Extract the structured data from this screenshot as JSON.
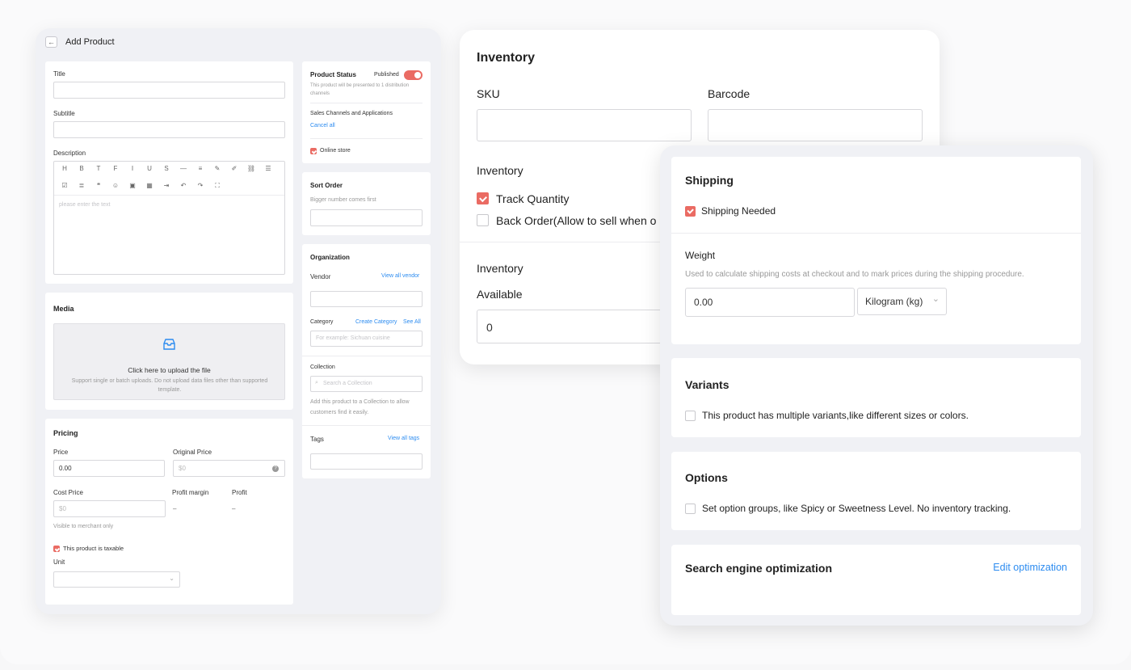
{
  "colors": {
    "accent": "#ea6b63",
    "link": "#2d8cf0"
  },
  "add_product": {
    "title": "Add Product",
    "title_label": "Title",
    "subtitle_label": "Subtitle",
    "description_label": "Description",
    "description_placeholder": "please enter the text",
    "toolbar_row1": [
      "H",
      "B",
      "T",
      "F",
      "I",
      "U",
      "S",
      "—",
      "≡",
      "✎",
      "✐",
      "⛓",
      "☰"
    ],
    "toolbar_row2": [
      "☑",
      "≣",
      "❝",
      "☺",
      "▣",
      "▦",
      "⇥",
      "↶",
      "↷",
      "⛶"
    ],
    "media": {
      "title": "Media",
      "upload_title": "Click here to upload the file",
      "upload_hint": "Support single or batch uploads. Do not upload data files other than supported template."
    },
    "pricing": {
      "title": "Pricing",
      "price_label": "Price",
      "price_value": "0.00",
      "original_price_label": "Original Price",
      "original_price_placeholder": "$0",
      "cost_price_label": "Cost Price",
      "cost_price_placeholder": "$0",
      "profit_margin_label": "Profit margin",
      "profit_margin_value": "–",
      "profit_label": "Profit",
      "profit_value": "–",
      "visible_note": "Visible to merchant only",
      "taxable_label": "This product is taxable",
      "unit_label": "Unit"
    },
    "status": {
      "title": "Product Status",
      "toggle_label": "Published",
      "note": "This product will be presented to 1 distribution channels",
      "channels_label": "Sales Channels and Applications",
      "cancel_all": "Cancel all",
      "online_store": "Online store"
    },
    "sort": {
      "title": "Sort Order",
      "hint": "Bigger number comes first"
    },
    "organization": {
      "title": "Organization",
      "vendor_label": "Vendor",
      "view_all_vendor": "View all vendor",
      "category_label": "Category",
      "create_category": "Create Category",
      "see_all": "See All",
      "category_placeholder": "For example: Sichuan cuisine",
      "collection_label": "Collection",
      "collection_placeholder": "Search a Collection",
      "collection_hint": "Add this product to a Collection to allow customers find it easily.",
      "tags_label": "Tags",
      "view_all_tags": "View all tags"
    }
  },
  "inventory": {
    "title": "Inventory",
    "sku_label": "SKU",
    "barcode_label": "Barcode",
    "section_label": "Inventory",
    "track_quantity": "Track Quantity",
    "back_order": "Back Order(Allow to sell when o",
    "section2_label": "Inventory",
    "available_label": "Available",
    "available_value": "0"
  },
  "shipping_panel": {
    "shipping_title": "Shipping",
    "shipping_needed": "Shipping Needed",
    "weight_label": "Weight",
    "weight_hint": "Used to calculate shipping costs at checkout and to mark prices during the shipping procedure.",
    "weight_value": "0.00",
    "weight_unit": "Kilogram (kg)",
    "variants_title": "Variants",
    "variants_option": "This product has multiple variants,like different sizes or colors.",
    "options_title": "Options",
    "options_option": "Set option groups, like Spicy or Sweetness Level. No inventory tracking.",
    "seo_title": "Search engine optimization",
    "seo_link": "Edit optimization"
  }
}
